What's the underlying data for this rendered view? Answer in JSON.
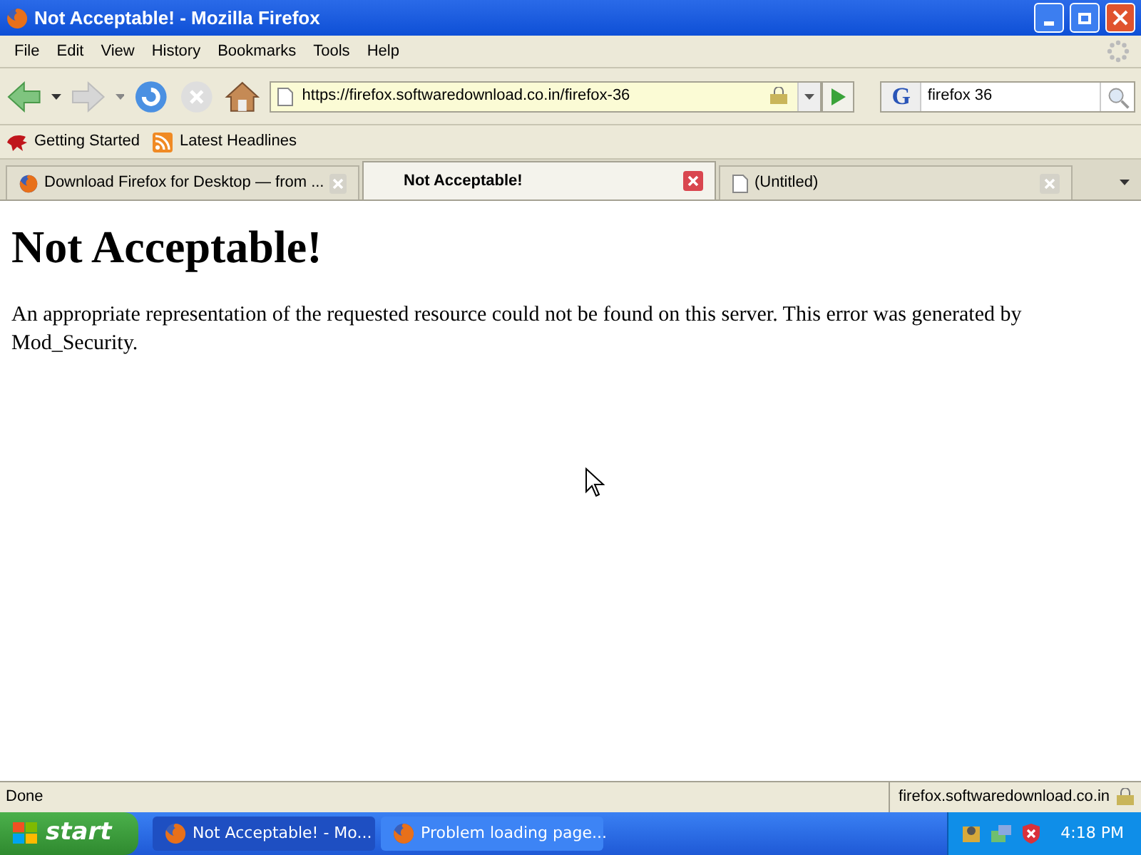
{
  "window": {
    "title": "Not Acceptable! - Mozilla Firefox"
  },
  "menu": [
    "File",
    "Edit",
    "View",
    "History",
    "Bookmarks",
    "Tools",
    "Help"
  ],
  "address": {
    "value": "https://firefox.softwaredownload.co.in/firefox-36"
  },
  "search": {
    "engine": "G",
    "value": "firefox 36"
  },
  "bookmarks": [
    {
      "label": "Getting Started",
      "kind": "star"
    },
    {
      "label": "Latest Headlines",
      "kind": "feed"
    }
  ],
  "tabs": [
    {
      "label": "Download Firefox for Desktop — from ...",
      "selected": false,
      "kind": "firefox"
    },
    {
      "label": "Not Acceptable!",
      "selected": true,
      "kind": "none"
    },
    {
      "label": "(Untitled)",
      "selected": false,
      "kind": "page"
    }
  ],
  "page": {
    "heading": "Not Acceptable!",
    "text": "An appropriate representation of the requested resource could not be found on this server. This error was generated by Mod_Security."
  },
  "status_bar": {
    "text": "Done",
    "host": "firefox.softwaredownload.co.in"
  },
  "taskbar": {
    "start": "start",
    "buttons": [
      {
        "label": "Not Acceptable! - Mo...",
        "selected": true
      },
      {
        "label": "Problem loading page...",
        "selected": false
      }
    ],
    "clock": "4:18 PM"
  }
}
